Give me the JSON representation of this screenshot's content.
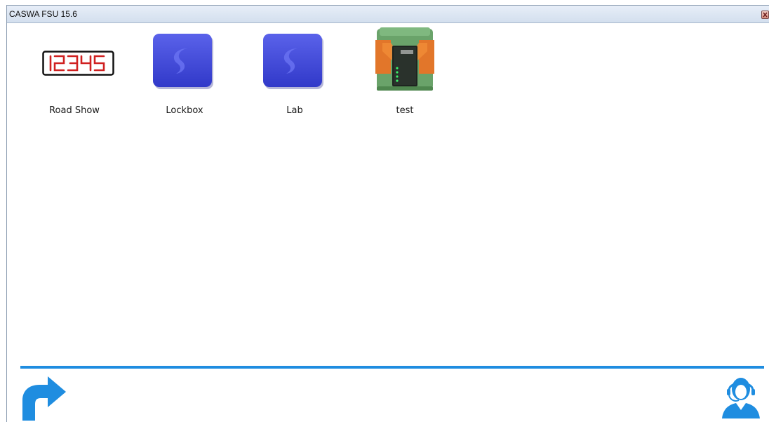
{
  "window": {
    "title": "CASWA FSU 15.6"
  },
  "devices": [
    {
      "label": "Road Show",
      "icon": "seven-segment-display-icon",
      "display_text": "12345",
      "display_color": "#d02020"
    },
    {
      "label": "Lockbox",
      "icon": "blue-box-icon",
      "tile_color": "#3f48d8"
    },
    {
      "label": "Lab",
      "icon": "blue-box-icon",
      "tile_color": "#3f48d8"
    },
    {
      "label": "test",
      "icon": "din-rail-module-icon",
      "housing_color": "#6aa36a",
      "accent_color": "#e2762a"
    }
  ],
  "footer": {
    "back_icon": "back-arrow-icon",
    "support_icon": "support-agent-icon",
    "accent": "#1f8de0"
  }
}
